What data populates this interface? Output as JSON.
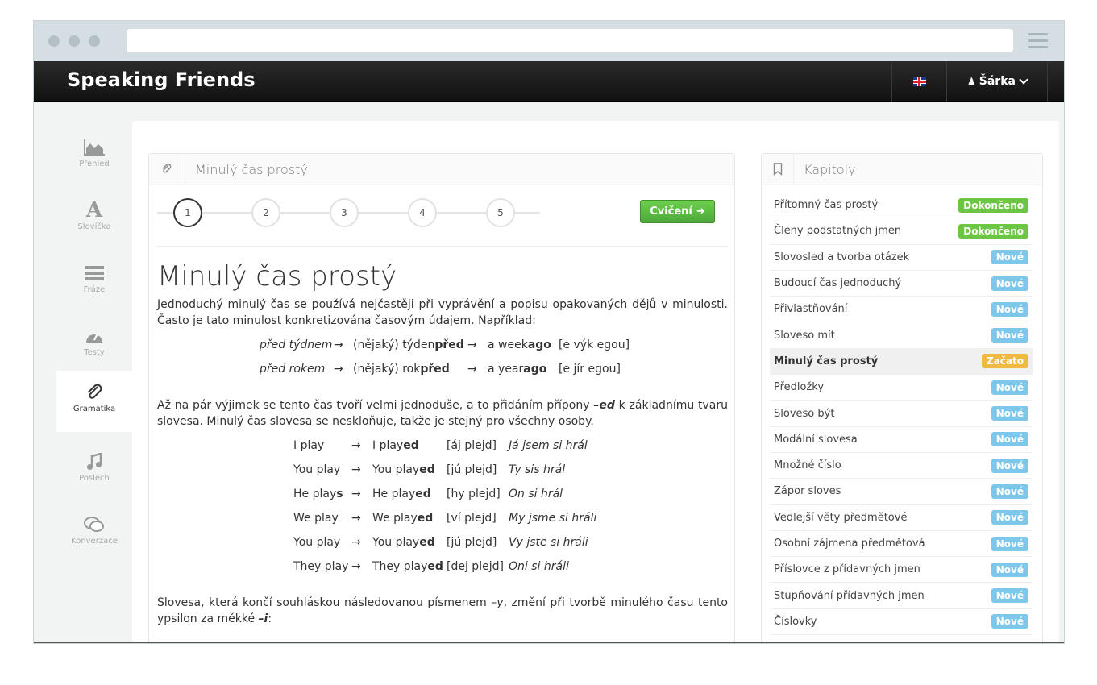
{
  "app": {
    "brand": "Speaking Friends",
    "user": "Šárka"
  },
  "sidebar": {
    "items": [
      {
        "label": "Přehled",
        "icon": "area-chart-icon"
      },
      {
        "label": "Slovíčka",
        "icon": "font-icon"
      },
      {
        "label": "Fráze",
        "icon": "list-icon"
      },
      {
        "label": "Testy",
        "icon": "dashboard-icon"
      },
      {
        "label": "Gramatika",
        "icon": "paperclip-icon",
        "active": true
      },
      {
        "label": "Poslech",
        "icon": "music-icon"
      },
      {
        "label": "Konverzace",
        "icon": "comments-icon"
      }
    ]
  },
  "lesson": {
    "panel_title": "Minulý čas prostý",
    "steps": [
      "1",
      "2",
      "3",
      "4",
      "5"
    ],
    "exercise_button": "Cvičení",
    "heading": "Minulý čas prostý",
    "p1": "Jednoduchý minulý čas se používá nejčastěji při vyprávění a popisu opakovaných dějů v minulosti. Často je tato minulost konkretizována časovým údajem. Například:",
    "ex1": [
      {
        "cz": "před týdnem",
        "arrow": "→",
        "mid_a": "(nějaký) týden ",
        "mid_b": "před",
        "arrow2": "→",
        "en_a": "a week ",
        "en_b": "ago",
        "pron": "[e výk egou]"
      },
      {
        "cz": "před rokem",
        "arrow": "→",
        "mid_a": "(nějaký) rok ",
        "mid_b": "před",
        "arrow2": "→",
        "en_a": "a year ",
        "en_b": "ago",
        "pron": "[e jír egou]"
      }
    ],
    "p2_a": "Až na pár výjimek se tento čas tvoří velmi jednoduše, a to přidáním přípony ",
    "p2_b": "–ed",
    "p2_c": " k základnímu tvaru slovesa. Minulý čas slovesa se neskloňuje, takže je stejný pro všechny osoby.",
    "conj": [
      {
        "base_a": "I play",
        "base_b": "",
        "arrow": "→",
        "past_a": "I play",
        "past_b": "ed",
        "pron": "[áj plejd]",
        "cz": "Já jsem si hrál"
      },
      {
        "base_a": "You play",
        "base_b": "",
        "arrow": "→",
        "past_a": "You play",
        "past_b": "ed",
        "pron": "[jú plejd]",
        "cz": "Ty sis hrál"
      },
      {
        "base_a": "He play",
        "base_b": "s",
        "arrow": "→",
        "past_a": "He play",
        "past_b": "ed",
        "pron": "[hy plejd]",
        "cz": "On si hrál"
      },
      {
        "base_a": "We play",
        "base_b": "",
        "arrow": "→",
        "past_a": "We play",
        "past_b": "ed",
        "pron": "[ví plejd]",
        "cz": "My jsme si hráli"
      },
      {
        "base_a": "You play",
        "base_b": "",
        "arrow": "→",
        "past_a": "You play",
        "past_b": "ed",
        "pron": "[jú plejd]",
        "cz": "Vy jste si hráli"
      },
      {
        "base_a": "They play",
        "base_b": "",
        "arrow": "→",
        "past_a": "They play",
        "past_b": "ed",
        "pron": "[dej plejd]",
        "cz": "Oni si hráli"
      }
    ],
    "p3_a": "Slovesa, která končí souhláskou následovanou písmenem ",
    "p3_b": "–y",
    "p3_c": ", změní při tvorbě minulého času tento ypsilon za měkké ",
    "p3_d": "–i",
    "p3_e": ":"
  },
  "chapters": {
    "title": "Kapitoly",
    "items": [
      {
        "label": "Přítomný čas prostý",
        "status": "Dokončeno",
        "color": "#6cc644"
      },
      {
        "label": "Členy podstatných jmen",
        "status": "Dokončeno",
        "color": "#6cc644"
      },
      {
        "label": "Slovosled a tvorba otázek",
        "status": "Nové",
        "color": "#7cc7ea"
      },
      {
        "label": "Budoucí čas jednoduchý",
        "status": "Nové",
        "color": "#7cc7ea"
      },
      {
        "label": "Přivlastňování",
        "status": "Nové",
        "color": "#7cc7ea"
      },
      {
        "label": "Sloveso mít",
        "status": "Nové",
        "color": "#7cc7ea"
      },
      {
        "label": "Minulý čas prostý",
        "status": "Začato",
        "color": "#f0b93f",
        "active": true
      },
      {
        "label": "Předložky",
        "status": "Nové",
        "color": "#7cc7ea"
      },
      {
        "label": "Sloveso být",
        "status": "Nové",
        "color": "#7cc7ea"
      },
      {
        "label": "Modální slovesa",
        "status": "Nové",
        "color": "#7cc7ea"
      },
      {
        "label": "Množné číslo",
        "status": "Nové",
        "color": "#7cc7ea"
      },
      {
        "label": "Zápor sloves",
        "status": "Nové",
        "color": "#7cc7ea"
      },
      {
        "label": "Vedlejší věty předmětové",
        "status": "Nové",
        "color": "#7cc7ea"
      },
      {
        "label": "Osobní zájmena předmětová",
        "status": "Nové",
        "color": "#7cc7ea"
      },
      {
        "label": "Příslovce z přídavných jmen",
        "status": "Nové",
        "color": "#7cc7ea"
      },
      {
        "label": "Stupňování přídavných jmen",
        "status": "Nové",
        "color": "#7cc7ea"
      },
      {
        "label": "Číslovky",
        "status": "Nové",
        "color": "#7cc7ea"
      }
    ]
  }
}
